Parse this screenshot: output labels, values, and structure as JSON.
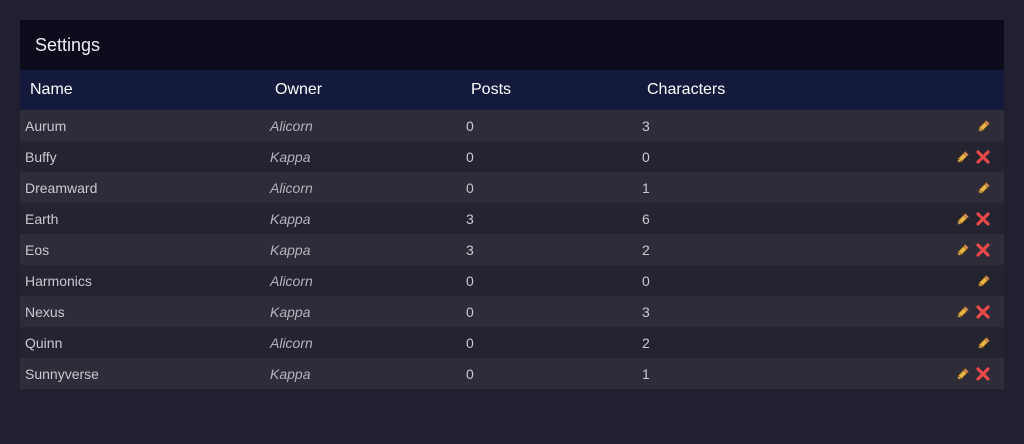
{
  "panel": {
    "title": "Settings"
  },
  "table": {
    "headers": {
      "name": "Name",
      "owner": "Owner",
      "posts": "Posts",
      "characters": "Characters"
    },
    "rows": [
      {
        "name": "Aurum",
        "owner": "Alicorn",
        "posts": "0",
        "characters": "3",
        "can_delete": false
      },
      {
        "name": "Buffy",
        "owner": "Kappa",
        "posts": "0",
        "characters": "0",
        "can_delete": true
      },
      {
        "name": "Dreamward",
        "owner": "Alicorn",
        "posts": "0",
        "characters": "1",
        "can_delete": false
      },
      {
        "name": "Earth",
        "owner": "Kappa",
        "posts": "3",
        "characters": "6",
        "can_delete": true
      },
      {
        "name": "Eos",
        "owner": "Kappa",
        "posts": "3",
        "characters": "2",
        "can_delete": true
      },
      {
        "name": "Harmonics",
        "owner": "Alicorn",
        "posts": "0",
        "characters": "0",
        "can_delete": false
      },
      {
        "name": "Nexus",
        "owner": "Kappa",
        "posts": "0",
        "characters": "3",
        "can_delete": true
      },
      {
        "name": "Quinn",
        "owner": "Alicorn",
        "posts": "0",
        "characters": "2",
        "can_delete": false
      },
      {
        "name": "Sunnyverse",
        "owner": "Kappa",
        "posts": "0",
        "characters": "1",
        "can_delete": true
      }
    ],
    "icons": {
      "edit": "pencil-icon",
      "delete": "delete-x-icon"
    }
  },
  "colors": {
    "page_bg": "#221f31",
    "title_bg": "#0b0b1c",
    "header_bg": "#141a3c",
    "row_odd": "#2d2c38",
    "row_even": "#242330",
    "pencil": "#e9b84a",
    "delete": "#e84a4a"
  }
}
